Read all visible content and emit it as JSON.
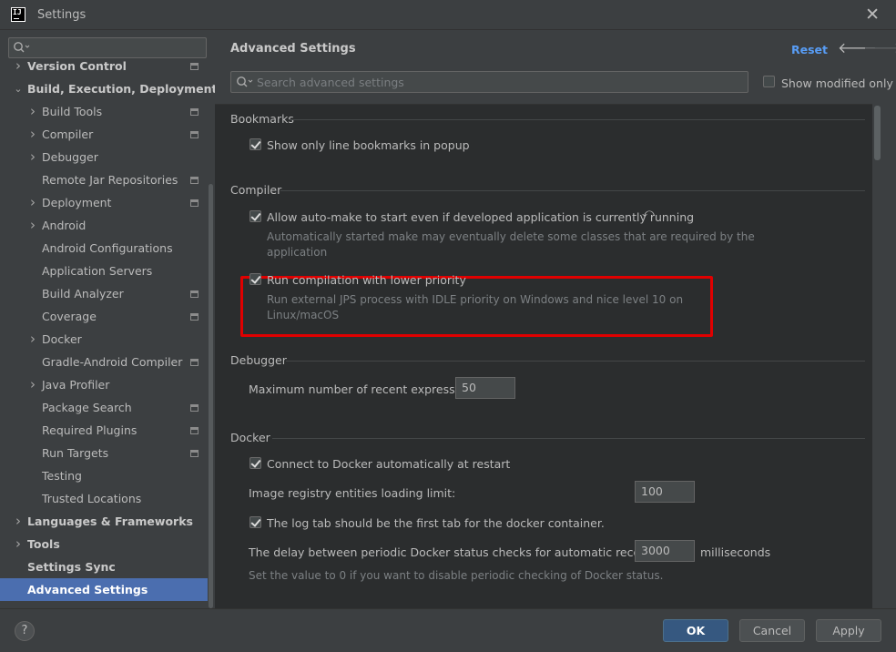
{
  "window": {
    "title": "Settings",
    "logo_text": "IJ"
  },
  "sidebar": {
    "search_placeholder": "",
    "items": [
      {
        "label": "Version Control",
        "level": 0,
        "expander": "collapsed",
        "bold": true,
        "project_icon": true
      },
      {
        "label": "Build, Execution, Deployment",
        "level": 0,
        "expander": "expanded",
        "bold": true,
        "project_icon": false
      },
      {
        "label": "Build Tools",
        "level": 1,
        "expander": "collapsed",
        "project_icon": true
      },
      {
        "label": "Compiler",
        "level": 1,
        "expander": "collapsed",
        "project_icon": true
      },
      {
        "label": "Debugger",
        "level": 1,
        "expander": "collapsed",
        "project_icon": false
      },
      {
        "label": "Remote Jar Repositories",
        "level": 1,
        "expander": "none",
        "project_icon": true
      },
      {
        "label": "Deployment",
        "level": 1,
        "expander": "collapsed",
        "project_icon": true
      },
      {
        "label": "Android",
        "level": 1,
        "expander": "collapsed",
        "project_icon": false
      },
      {
        "label": "Android Configurations",
        "level": 1,
        "expander": "none",
        "project_icon": false
      },
      {
        "label": "Application Servers",
        "level": 1,
        "expander": "none",
        "project_icon": false
      },
      {
        "label": "Build Analyzer",
        "level": 1,
        "expander": "none",
        "project_icon": true
      },
      {
        "label": "Coverage",
        "level": 1,
        "expander": "none",
        "project_icon": true
      },
      {
        "label": "Docker",
        "level": 1,
        "expander": "collapsed",
        "project_icon": false
      },
      {
        "label": "Gradle-Android Compiler",
        "level": 1,
        "expander": "none",
        "project_icon": true
      },
      {
        "label": "Java Profiler",
        "level": 1,
        "expander": "collapsed",
        "project_icon": false
      },
      {
        "label": "Package Search",
        "level": 1,
        "expander": "none",
        "project_icon": true
      },
      {
        "label": "Required Plugins",
        "level": 1,
        "expander": "none",
        "project_icon": true
      },
      {
        "label": "Run Targets",
        "level": 1,
        "expander": "none",
        "project_icon": true
      },
      {
        "label": "Testing",
        "level": 1,
        "expander": "none",
        "project_icon": false
      },
      {
        "label": "Trusted Locations",
        "level": 1,
        "expander": "none",
        "project_icon": false
      },
      {
        "label": "Languages & Frameworks",
        "level": 0,
        "expander": "collapsed",
        "bold": true,
        "project_icon": false
      },
      {
        "label": "Tools",
        "level": 0,
        "expander": "collapsed",
        "bold": true,
        "project_icon": false
      },
      {
        "label": "Settings Sync",
        "level": 0,
        "expander": "none",
        "bold": true,
        "project_icon": false
      },
      {
        "label": "Advanced Settings",
        "level": 0,
        "expander": "none",
        "bold": true,
        "selected": true,
        "project_icon": false
      }
    ]
  },
  "main": {
    "title": "Advanced Settings",
    "reset_label": "Reset",
    "search_placeholder": "Search advanced settings",
    "show_modified_label": "Show modified only",
    "show_modified_checked": false,
    "sections": {
      "bookmarks": {
        "title": "Bookmarks",
        "line_bookmarks_label": "Show only line bookmarks in popup",
        "line_bookmarks_checked": true
      },
      "compiler": {
        "title": "Compiler",
        "automake_label": "Allow auto-make to start even if developed application is currently running",
        "automake_checked": true,
        "automake_hint_1": "Automatically started make may eventually delete some classes that are required by the",
        "automake_hint_2": "application",
        "lowprio_label": "Run compilation with lower priority",
        "lowprio_checked": true,
        "lowprio_hint_1": "Run external JPS process with IDLE priority on Windows and nice level 10 on",
        "lowprio_hint_2": "Linux/macOS"
      },
      "debugger": {
        "title": "Debugger",
        "recent_expr_label": "Maximum number of recent expressions:",
        "recent_expr_value": "50"
      },
      "docker": {
        "title": "Docker",
        "connect_label": "Connect to Docker automatically at restart",
        "connect_checked": true,
        "registry_limit_label": "Image registry entities loading limit:",
        "registry_limit_value": "100",
        "log_tab_label": "The log tab should be the first tab for the docker container.",
        "log_tab_checked": true,
        "delay_label": "The delay between periodic Docker status checks for automatic reconnection:",
        "delay_value": "3000",
        "delay_unit": "milliseconds",
        "delay_hint": "Set the value to 0 if you want to disable periodic checking of Docker status."
      }
    }
  },
  "footer": {
    "help_label": "?",
    "ok_label": "OK",
    "cancel_label": "Cancel",
    "apply_label": "Apply"
  },
  "colors": {
    "background": "#3c3f41",
    "content_background": "#2b2d2e",
    "selection": "#4b6eaf",
    "link": "#589df6",
    "primary_button": "#365880",
    "highlight_border": "#e00000"
  }
}
